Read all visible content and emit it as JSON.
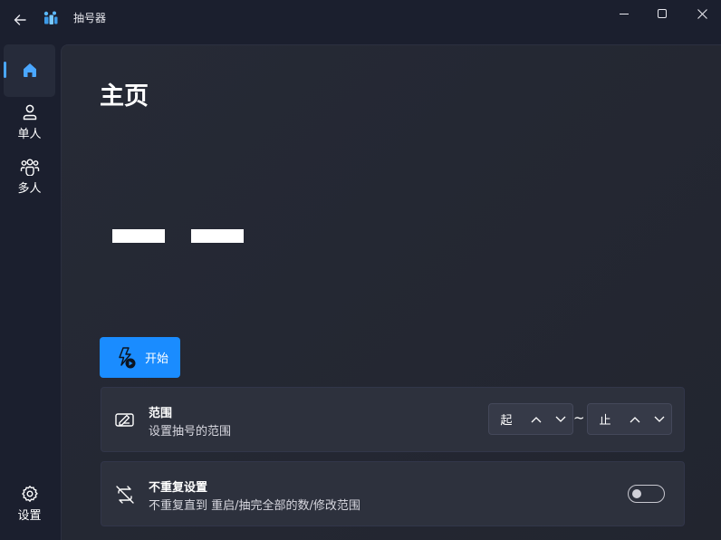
{
  "window": {
    "title": "抽号器",
    "colors": {
      "accent": "#1a8cff",
      "nav_indicator": "#4aa7ff",
      "background": "#1b1f2e",
      "card": "#2d313d"
    }
  },
  "nav": {
    "items": [
      {
        "label": "",
        "icon": "home-icon",
        "active": true
      },
      {
        "label": "单人",
        "icon": "person-icon"
      },
      {
        "label": "多人",
        "icon": "people-icon"
      }
    ],
    "footer": {
      "label": "设置",
      "icon": "gear-icon"
    }
  },
  "main": {
    "title": "主页",
    "start_button": {
      "label": "开始",
      "icon": "flash-play-icon"
    },
    "range_card": {
      "title": "范围",
      "description": "设置抽号的范围",
      "start_value": "起",
      "end_value": "止",
      "separator": "~"
    },
    "norepeat_card": {
      "title": "不重复设置",
      "description": "不重复直到 重启/抽完全部的数/修改范围",
      "toggle_on": false
    }
  }
}
